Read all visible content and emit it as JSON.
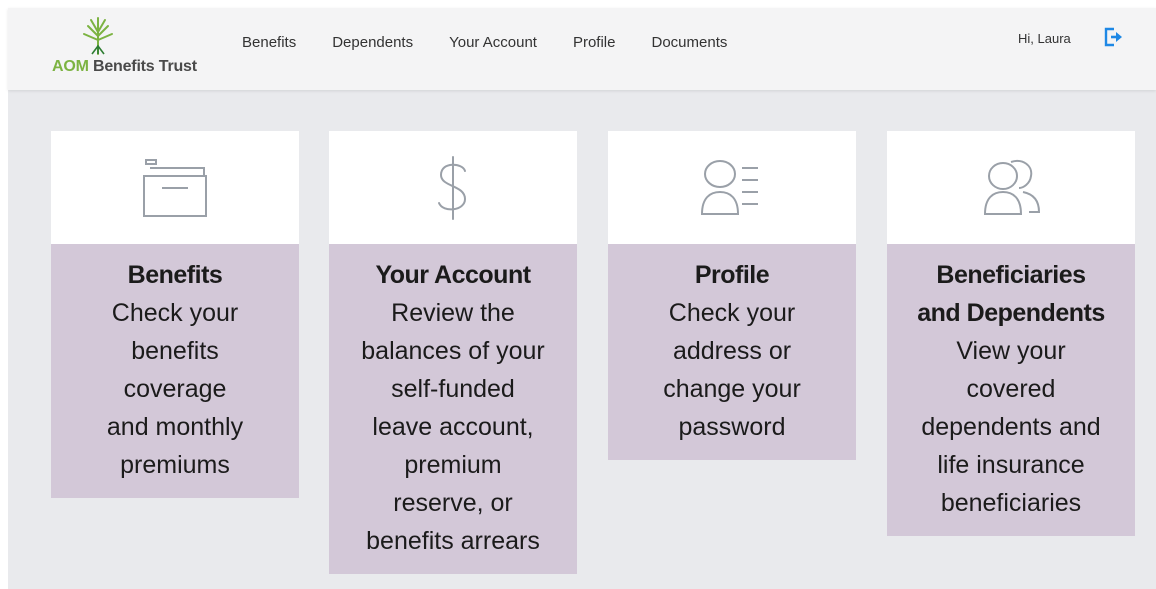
{
  "header": {
    "logo": {
      "brand_prefix": "AOM",
      "brand_suffix": "Benefits Trust",
      "accent": "#7cb342",
      "icon": "tree-logo-icon"
    },
    "nav": [
      "Benefits",
      "Dependents",
      "Your Account",
      "Profile",
      "Documents"
    ],
    "greeting": "Hi, Laura",
    "logout_icon": "logout-icon",
    "logout_color": "#1e88e5"
  },
  "cards": [
    {
      "icon": "folder-icon",
      "title": "Benefits",
      "lines": [
        "Check your",
        "benefits",
        "coverage",
        "and monthly",
        "premiums"
      ]
    },
    {
      "icon": "dollar-icon",
      "title": "Your Account",
      "lines": [
        "Review the",
        "balances of your",
        "self-funded",
        "leave account,",
        "premium",
        "reserve, or",
        "benefits arrears"
      ]
    },
    {
      "icon": "profile-card-icon",
      "title": "Profile",
      "lines": [
        "Check your",
        "address or",
        "change your",
        "password"
      ]
    },
    {
      "icon": "people-icon",
      "title_lines": [
        "Beneficiaries",
        "and Dependents"
      ],
      "lines": [
        "View your",
        "covered",
        "dependents and",
        "life insurance",
        "beneficiaries"
      ]
    }
  ],
  "colors": {
    "card_band": "#d3c8d8",
    "background": "#e9eaed",
    "icon_stroke": "#9aa0a8"
  }
}
